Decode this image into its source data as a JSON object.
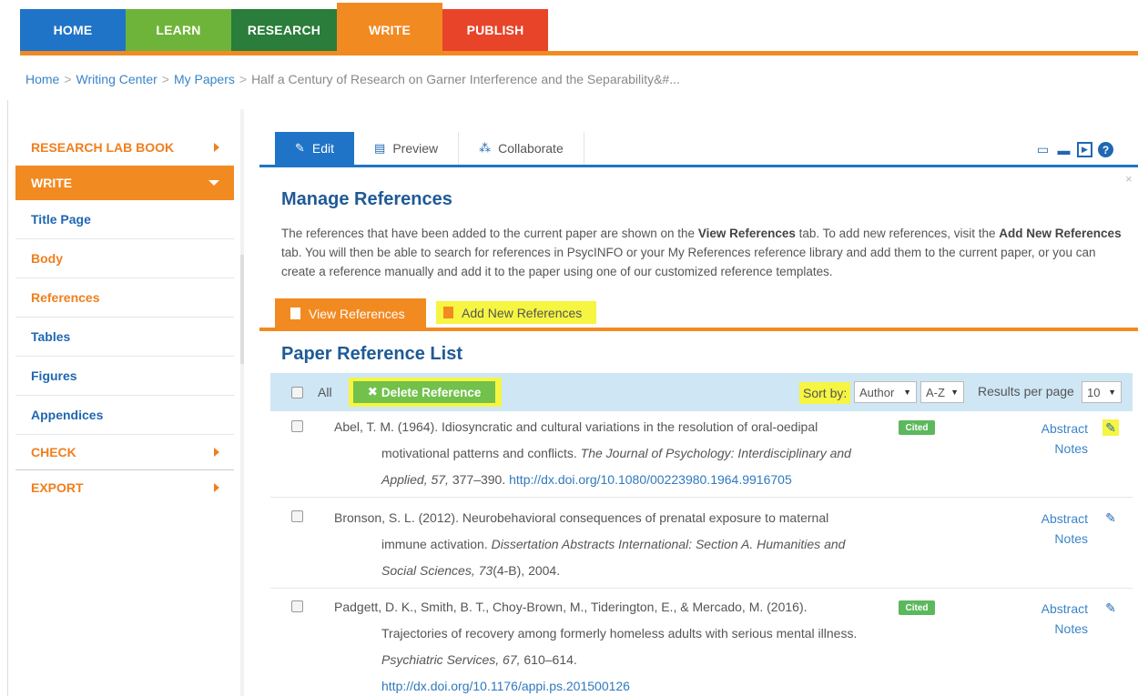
{
  "nav": {
    "tabs": [
      {
        "label": "HOME"
      },
      {
        "label": "LEARN"
      },
      {
        "label": "RESEARCH"
      },
      {
        "label": "WRITE"
      },
      {
        "label": "PUBLISH"
      }
    ],
    "active": "WRITE"
  },
  "breadcrumb": {
    "items": [
      "Home",
      "Writing Center",
      "My Papers"
    ],
    "current": "Half a Century of Research on Garner Interference and the Separability&#...",
    "separator": ">"
  },
  "sidebar": {
    "research_lab_book": "RESEARCH LAB BOOK",
    "write": "WRITE",
    "items": [
      "Title Page",
      "Body",
      "References",
      "Tables",
      "Figures",
      "Appendices"
    ],
    "check": "CHECK",
    "export": "EXPORT"
  },
  "editor_tabs": {
    "edit": "Edit",
    "preview": "Preview",
    "collaborate": "Collaborate"
  },
  "manage": {
    "title": "Manage References",
    "desc_1": "The references that have been added to the current paper are shown on the ",
    "desc_b1": "View References",
    "desc_2": " tab. To add new references, visit the ",
    "desc_b2": "Add New References",
    "desc_3": " tab. You will then be able to search for references in PsycINFO or your My References reference library and add them to the current paper, or you can create a reference manually and add it to the paper using one of our customized reference templates."
  },
  "subtabs": {
    "view": "View References",
    "add": "Add New References"
  },
  "list": {
    "title": "Paper Reference List",
    "all_label": "All",
    "delete_label": "Delete Reference",
    "sort_by_label": "Sort by:",
    "sort_field": "Author",
    "sort_order": "A-Z",
    "results_label": "Results per page",
    "results_value": "10",
    "abstract_label": "Abstract",
    "notes_label": "Notes",
    "cited_label": "Cited"
  },
  "references": [
    {
      "first": "Abel, T. M. (1964). Idiosyncratic and cultural variations in the resolution of oral-oedipal",
      "rest_1": "motivational patterns and conflicts. ",
      "journal": "The Journal of Psychology: Interdisciplinary and Applied, 57,",
      "pages": " 377–390. ",
      "doi": "http://dx.doi.org/10.1080/00223980.1964.9916705",
      "cited": true
    },
    {
      "first": "Bronson, S. L. (2012). Neurobehavioral consequences of prenatal exposure to maternal",
      "rest_1": "immune activation. ",
      "journal": "Dissertation Abstracts International: Section A. Humanities and Social Sciences, 73",
      "pages": "(4-B), 2004.",
      "doi": "",
      "cited": false
    },
    {
      "first": "Padgett, D. K., Smith, B. T., Choy-Brown, M., Tiderington, E., & Mercado, M. (2016).",
      "rest_1": "Trajectories of recovery among formerly homeless adults with serious mental illness. ",
      "journal": "Psychiatric Services, 67,",
      "pages": " 610–614.",
      "doi": "http://dx.doi.org/10.1176/appi.ps.201500126",
      "cited": true
    }
  ],
  "colors": {
    "home": "#1f74c7",
    "learn": "#6fb43a",
    "research": "#2a7d3a",
    "write": "#f28a22",
    "publish": "#e8442a",
    "highlight": "#f5f542",
    "cited": "#5cb85c"
  }
}
